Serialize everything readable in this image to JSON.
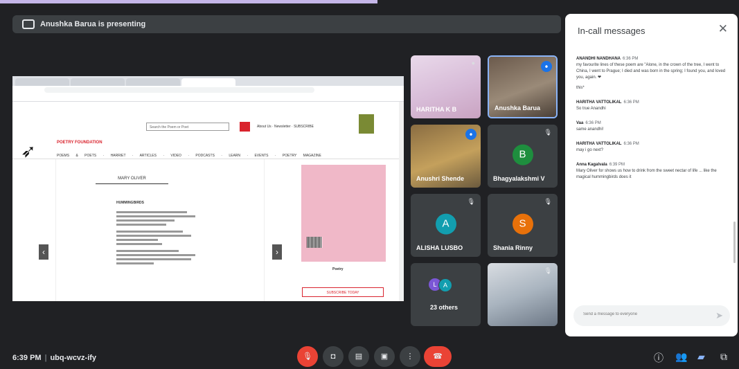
{
  "meet": {
    "presenting_text": "Anushka Barua is presenting",
    "meeting_time": "6:39 PM",
    "meeting_code": "ubq-wcvz-ify"
  },
  "shared_screen": {
    "site_search_placeholder": "Search the Poem or Poet",
    "about_links": "About Us · Newsletter · SUBSCRIBE",
    "foundation_name": "POETRY FOUNDATION",
    "nav_items": "POEMS & POETS · HARRIET · ARTICLES · VIDEO · PODCASTS · LEARN · EVENTS · POETRY MAGAZINE",
    "author": "MARY OLIVER",
    "poem_title": "HUMMINGBIRDS",
    "book_title": "Poetry",
    "subscribe_label": "SUBSCRIBE TODAY"
  },
  "participants": [
    {
      "name": "HARITHA K B",
      "initial": ""
    },
    {
      "name": "Anushka Barua",
      "initial": ""
    },
    {
      "name": "Anushri Shende",
      "initial": ""
    },
    {
      "name": "Bhagyalakshmi V",
      "initial": "B"
    },
    {
      "name": "ALISHA LUSBO",
      "initial": "A"
    },
    {
      "name": "Shania Rinny",
      "initial": "S"
    },
    {
      "name": "23 others",
      "initial": "L"
    },
    {
      "name": "",
      "initial": ""
    }
  ],
  "others_initials": [
    "L",
    "A"
  ],
  "chat": {
    "title": "In-call messages",
    "messages": [
      {
        "sender": "ANANDHI NANDHANA",
        "time": "6:36 PM",
        "text": "my favourite lines of these poem are \"Alone, in the crown of the tree, I went to China, I went to Prague; I died and was born in the spring; I found you, and loved you, again. ❤"
      },
      {
        "sender": "",
        "time": "",
        "text": "this*"
      },
      {
        "sender": "HARITHA VATTOLIKAL",
        "time": "6:36 PM",
        "text": "So true Anandhi"
      },
      {
        "sender": "Vaa",
        "time": "6:36 PM",
        "text": "same anandhi!"
      },
      {
        "sender": "HARITHA VATTOLIKAL",
        "time": "6:36 PM",
        "text": "may i go next?"
      },
      {
        "sender": "Anna Kagalvala",
        "time": "6:39 PM",
        "text": "Mary Oliver for shows us how to drink from the sweet nectar of life ... like the magical hummingbirds does it"
      }
    ],
    "input_placeholder": "Send a message to everyone"
  },
  "colors": {
    "avatar_b": "#1e8e3e",
    "avatar_a": "#129eaf",
    "avatar_s": "#e8710a",
    "avatar_l": "#7b57d6",
    "end_call": "#ea4335",
    "active_chat": "#8ab4f8"
  },
  "icons": {
    "controls": [
      "mic-off-icon",
      "camera-icon",
      "captions-icon",
      "present-icon",
      "more-icon",
      "end-call-icon"
    ],
    "right": [
      "info-icon",
      "people-icon",
      "chat-icon",
      "activities-icon"
    ]
  }
}
